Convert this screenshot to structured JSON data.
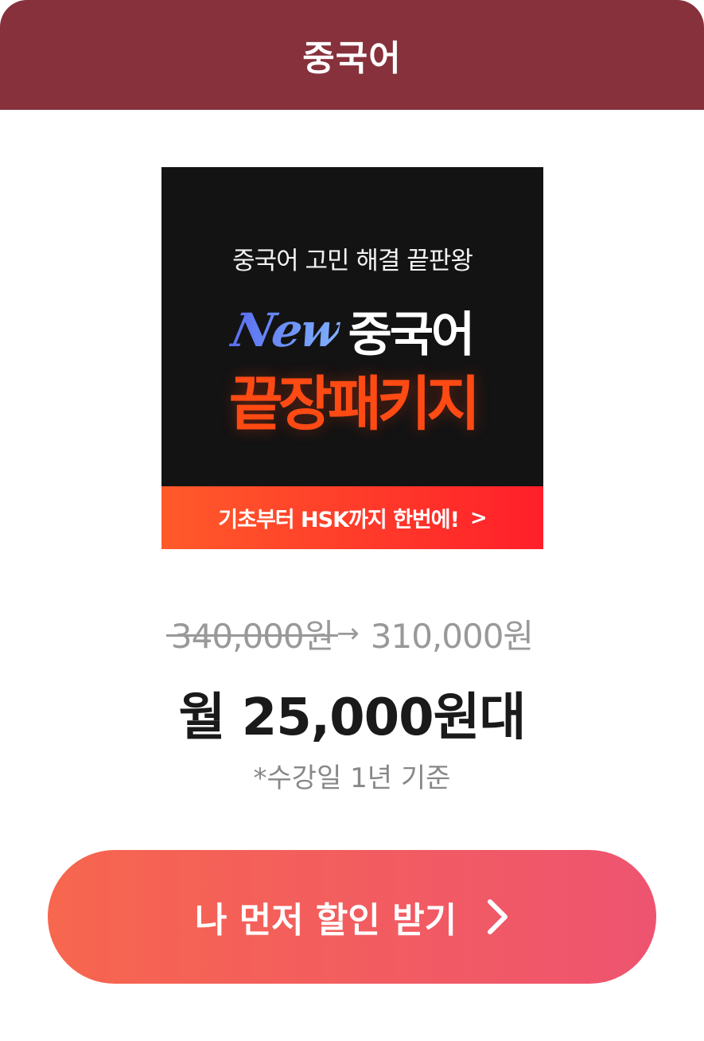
{
  "header": {
    "title": "중국어"
  },
  "banner": {
    "tagline": "중국어 고민 해결 끝판왕",
    "new_label": "New",
    "title_lang": "중국어",
    "title_package": "끝장패키지",
    "bottom_bar": "기초부터 HSK까지 한번에!",
    "bottom_bar_icon": "chevron-right-icon"
  },
  "pricing": {
    "original_price": "340,000원",
    "discounted_price": "310,000원",
    "monthly_price": "월 25,000원대",
    "note": "*수강일 1년 기준"
  },
  "cta": {
    "label": "나 먼저 할인 받기",
    "icon": "chevron-right-icon"
  },
  "colors": {
    "header_bg": "#86313b",
    "cta_gradient_start": "#f7664e",
    "cta_gradient_end": "#ee5470",
    "banner_accent": "#ff4a14"
  }
}
